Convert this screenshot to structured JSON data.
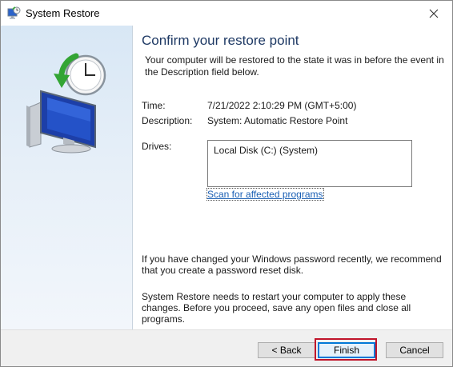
{
  "window": {
    "title": "System Restore",
    "title_icon": "system-restore-icon",
    "close_icon": "close-icon"
  },
  "sidebar": {
    "illustration": "monitor-with-clock-restore-illustration"
  },
  "content": {
    "heading": "Confirm your restore point",
    "intro": "Your computer will be restored to the state it was in before the event in the Description field below.",
    "time_label": "Time:",
    "time_value": "7/21/2022 2:10:29 PM (GMT+5:00)",
    "description_label": "Description:",
    "description_value": "System: Automatic Restore Point",
    "drives_label": "Drives:",
    "drives": [
      "Local Disk (C:) (System)"
    ],
    "scan_link": "Scan for affected programs",
    "password_note": "If you have changed your Windows password recently, we recommend that you create a password reset disk.",
    "restart_note": "System Restore needs to restart your computer to apply these changes. Before you proceed, save any open files and close all programs."
  },
  "buttons": {
    "back": "< Back",
    "finish": "Finish",
    "cancel": "Cancel"
  },
  "colors": {
    "heading": "#1e3964",
    "link": "#1a5fb4",
    "highlight": "#c0142a",
    "default_button_border": "#0078d7"
  }
}
